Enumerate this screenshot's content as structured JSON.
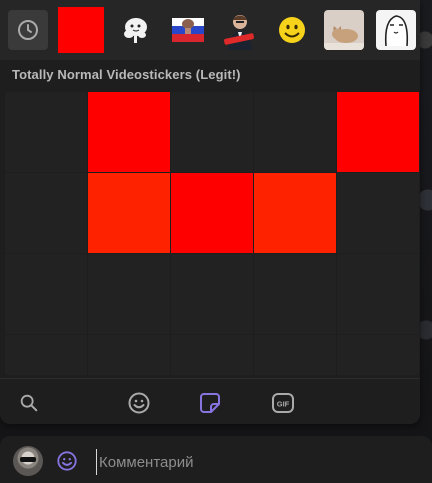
{
  "sticker_panel": {
    "section_title": "Totally Normal Videostickers (Legit!)",
    "sets": [
      {
        "name": "recent",
        "icon": "clock-icon"
      },
      {
        "name": "red-square-set",
        "icon": "red-square-icon"
      },
      {
        "name": "white-blob-set",
        "icon": "white-blob-icon"
      },
      {
        "name": "flag-face-set",
        "icon": "flag-icon"
      },
      {
        "name": "portrait-set",
        "icon": "portrait-icon"
      },
      {
        "name": "smiley-set",
        "icon": "smiley-icon"
      },
      {
        "name": "cat-set",
        "icon": "cat-icon"
      },
      {
        "name": "drawn-face-set",
        "icon": "drawn-face-icon"
      },
      {
        "name": "cut-off-set",
        "icon": "cut-off-icon"
      }
    ],
    "grid_rows": [
      [
        "empty",
        "red",
        "empty",
        "empty",
        "red"
      ],
      [
        "empty",
        "red-orange",
        "red",
        "red-orange",
        "empty"
      ],
      [
        "empty",
        "empty",
        "empty",
        "empty",
        "empty"
      ]
    ],
    "bottom_tabs": [
      {
        "name": "search",
        "icon": "search-icon"
      },
      {
        "name": "emoji",
        "icon": "emoji-icon"
      },
      {
        "name": "stickers",
        "icon": "sticker-icon",
        "active": true
      },
      {
        "name": "gif",
        "icon": "gif-icon",
        "label": "GIF"
      }
    ]
  },
  "composer": {
    "placeholder": "Комментарий",
    "value": ""
  },
  "colors": {
    "accent": "#8774e1",
    "panel_bg": "#1e1e1e",
    "sets_bar_bg": "#262626",
    "sticker_red": "#ff0000",
    "sticker_red_orange": "#ff2200",
    "icon_gray": "#aaaaaa"
  }
}
